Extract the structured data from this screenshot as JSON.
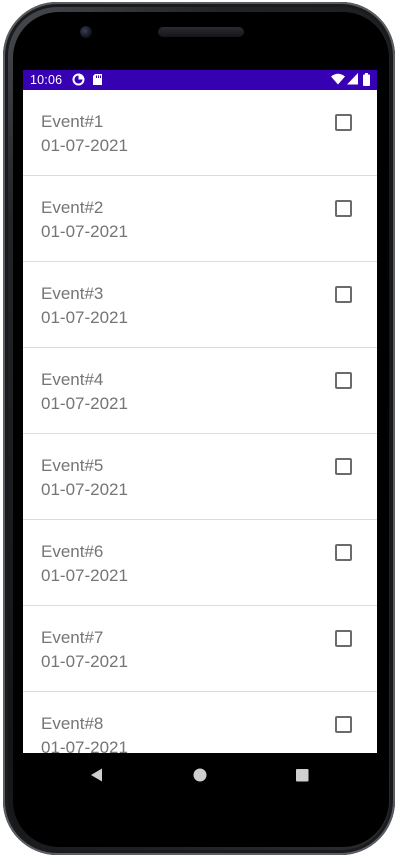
{
  "status_bar": {
    "time": "10:06",
    "icons": [
      "data-saver-icon",
      "sd-card-icon",
      "wifi-icon",
      "signal-icon",
      "battery-icon"
    ],
    "background_color": "#3700b3"
  },
  "events": [
    {
      "title": "Event#1",
      "date": "01-07-2021",
      "checked": false
    },
    {
      "title": "Event#2",
      "date": "01-07-2021",
      "checked": false
    },
    {
      "title": "Event#3",
      "date": "01-07-2021",
      "checked": false
    },
    {
      "title": "Event#4",
      "date": "01-07-2021",
      "checked": false
    },
    {
      "title": "Event#5",
      "date": "01-07-2021",
      "checked": false
    },
    {
      "title": "Event#6",
      "date": "01-07-2021",
      "checked": false
    },
    {
      "title": "Event#7",
      "date": "01-07-2021",
      "checked": false
    },
    {
      "title": "Event#8",
      "date": "01-07-2021",
      "checked": false
    }
  ],
  "nav_bar": {
    "buttons": [
      "back-icon",
      "home-icon",
      "recents-icon"
    ]
  },
  "colors": {
    "text": "#757575",
    "divider": "#dcdcdc",
    "accent": "#3700b3"
  }
}
